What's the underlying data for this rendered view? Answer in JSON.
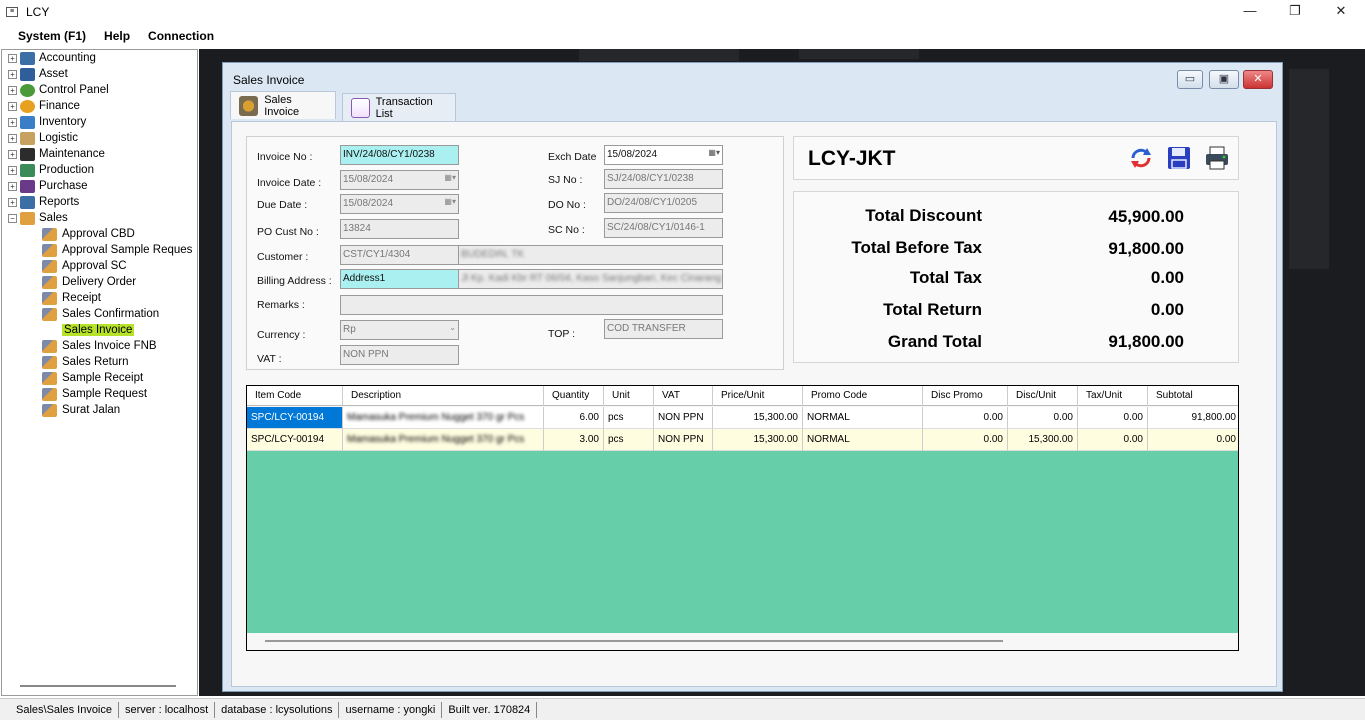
{
  "app": {
    "title": "LCY"
  },
  "window_controls": {
    "minimize": "—",
    "restore": "❐",
    "close": "✕"
  },
  "menu": [
    "System (F1)",
    "Help",
    "Connection"
  ],
  "tree": {
    "roots": [
      "Accounting",
      "Asset",
      "Control Panel",
      "Finance",
      "Inventory",
      "Logistic",
      "Maintenance",
      "Production",
      "Purchase",
      "Reports",
      "Sales"
    ],
    "sales_children": [
      "Approval CBD",
      "Approval Sample Reques",
      "Approval SC",
      "Delivery Order",
      "Receipt",
      "Sales Confirmation",
      "Sales Invoice",
      "Sales Invoice FNB",
      "Sales Return",
      "Sample Receipt",
      "Sample Request",
      "Surat Jalan"
    ],
    "selected": "Sales Invoice",
    "colors": {
      "selected_bg": "#b6e32a"
    }
  },
  "mdi": {
    "title": "Sales Invoice",
    "tabs": [
      "Sales Invoice",
      "Transaction List"
    ],
    "btns": {
      "min": "▭",
      "max": "▣",
      "close": "✕"
    }
  },
  "form": {
    "invoice_no_label": "Invoice No :",
    "invoice_no": "INV/24/08/CY1/0238",
    "invoice_date_label": "Invoice Date :",
    "invoice_date": "15/08/2024",
    "due_date_label": "Due Date :",
    "due_date": "15/08/2024",
    "po_cust_no_label": "PO Cust No :",
    "po_cust_no": "13824",
    "customer_label": "Customer :",
    "customer_code": "CST/CY1/4304",
    "customer_name": "BUDEDIN, TK",
    "billing_label": "Billing Address :",
    "billing_address": "Address1",
    "billing_text": "Jl Kp. Kadi Kbr RT 06/04, Kaso Sanjungbari, Kec Cinarang",
    "remarks_label": "Remarks :",
    "remarks": "",
    "currency_label": "Currency :",
    "currency": "Rp",
    "vat_label": "VAT :",
    "vat": "NON PPN",
    "exch_date_label": "Exch Date",
    "exch_date": "15/08/2024",
    "sj_no_label": "SJ No :",
    "sj_no": "SJ/24/08/CY1/0238",
    "do_no_label": "DO No :",
    "do_no": "DO/24/08/CY1/0205",
    "sc_no_label": "SC No :",
    "sc_no": "SC/24/08/CY1/0146-1",
    "top_label": "TOP :",
    "top": "COD TRANSFER"
  },
  "summary": {
    "location": "LCY-JKT",
    "rows": [
      {
        "label": "Total Discount",
        "value": "45,900.00"
      },
      {
        "label": "Total Before Tax",
        "value": "91,800.00"
      },
      {
        "label": "Total Tax",
        "value": "0.00"
      },
      {
        "label": "Total Return",
        "value": "0.00"
      },
      {
        "label": "Grand Total",
        "value": "91,800.00"
      }
    ],
    "icons": [
      "refresh-icon",
      "save-icon",
      "print-icon"
    ]
  },
  "grid": {
    "columns": [
      "Item Code",
      "Description",
      "Quantity",
      "Unit",
      "VAT",
      "Price/Unit",
      "Promo Code",
      "Disc Promo",
      "Disc/Unit",
      "Tax/Unit",
      "Subtotal"
    ],
    "rows": [
      [
        "SPC/LCY-00194",
        "Mamasuka Premium Nugget 370 gr Pcs",
        "6.00",
        "pcs",
        "NON PPN",
        "15,300.00",
        "NORMAL",
        "0.00",
        "0.00",
        "0.00",
        "91,800.00"
      ],
      [
        "SPC/LCY-00194",
        "Mamasuka Premium Nugget 370 gr Pcs",
        "3.00",
        "pcs",
        "NON PPN",
        "15,300.00",
        "NORMAL",
        "0.00",
        "15,300.00",
        "0.00",
        "0.00"
      ]
    ],
    "colors": {
      "selected_cell": "#0078d7",
      "row2_bg": "#fffde0",
      "empty_area": "#66cfaa"
    }
  },
  "status": [
    "Sales\\Sales Invoice",
    "server : localhost",
    "database : lcysolutions",
    "username : yongki",
    "Built ver. 170824"
  ]
}
